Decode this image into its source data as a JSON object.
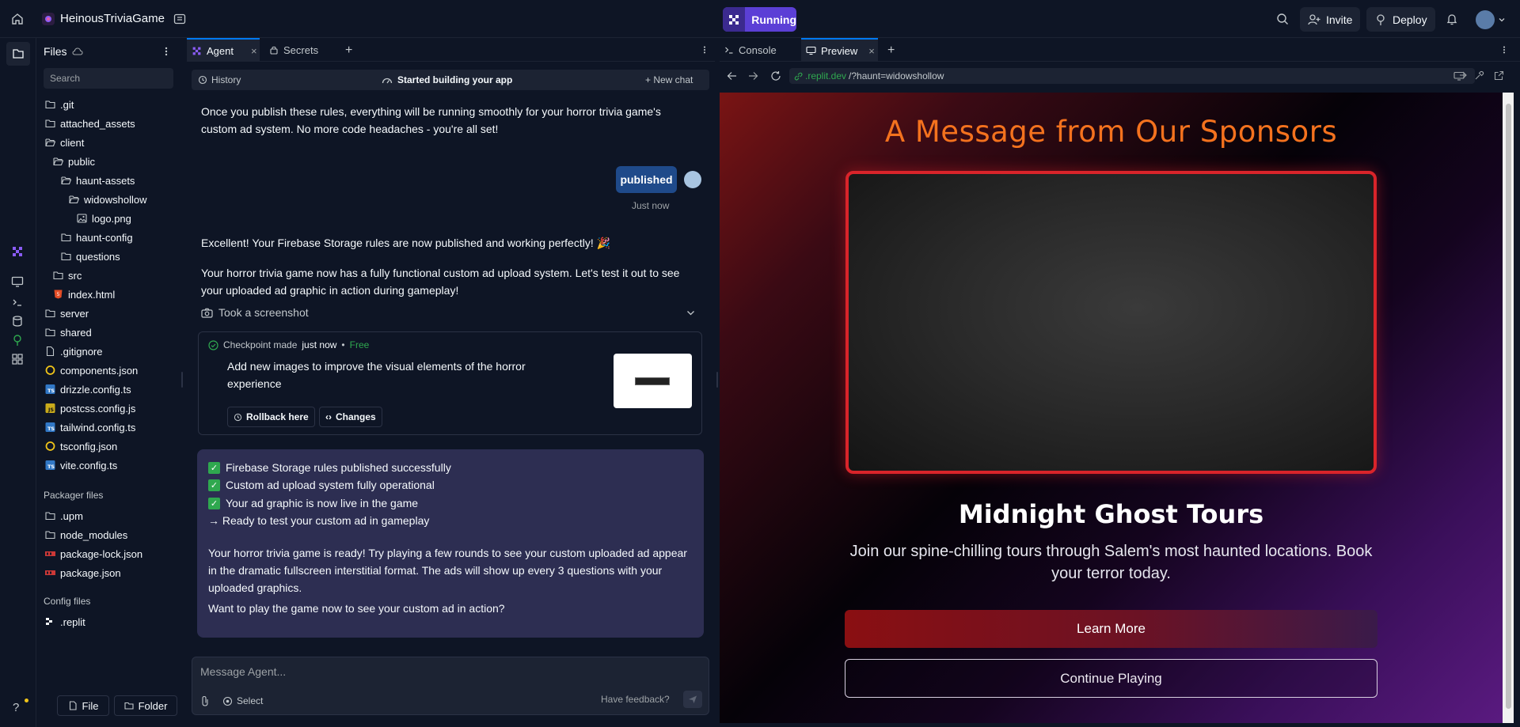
{
  "topbar": {
    "app_name": "HeinousTriviaGame",
    "run_label": "Running",
    "invite_label": "Invite",
    "deploy_label": "Deploy"
  },
  "files": {
    "title": "Files",
    "search_placeholder": "Search",
    "tree": [
      {
        "name": ".git",
        "type": "folder",
        "depth": 0
      },
      {
        "name": "attached_assets",
        "type": "folder",
        "depth": 0
      },
      {
        "name": "client",
        "type": "folder-open",
        "depth": 0
      },
      {
        "name": "public",
        "type": "folder-open",
        "depth": 1
      },
      {
        "name": "haunt-assets",
        "type": "folder-open",
        "depth": 2
      },
      {
        "name": "widowshollow",
        "type": "folder-open",
        "depth": 3
      },
      {
        "name": "logo.png",
        "type": "image",
        "depth": 4
      },
      {
        "name": "haunt-config",
        "type": "folder",
        "depth": 2
      },
      {
        "name": "questions",
        "type": "folder",
        "depth": 2
      },
      {
        "name": "src",
        "type": "folder",
        "depth": 1
      },
      {
        "name": "index.html",
        "type": "html",
        "depth": 1
      },
      {
        "name": "server",
        "type": "folder",
        "depth": 0
      },
      {
        "name": "shared",
        "type": "folder",
        "depth": 0
      },
      {
        "name": ".gitignore",
        "type": "file",
        "depth": 0
      },
      {
        "name": "components.json",
        "type": "json",
        "depth": 0
      },
      {
        "name": "drizzle.config.ts",
        "type": "ts",
        "depth": 0
      },
      {
        "name": "postcss.config.js",
        "type": "js",
        "depth": 0
      },
      {
        "name": "tailwind.config.ts",
        "type": "ts",
        "depth": 0
      },
      {
        "name": "tsconfig.json",
        "type": "json",
        "depth": 0
      },
      {
        "name": "vite.config.ts",
        "type": "ts",
        "depth": 0
      }
    ],
    "packager_label": "Packager files",
    "packager": [
      {
        "name": ".upm",
        "type": "folder"
      },
      {
        "name": "node_modules",
        "type": "folder"
      },
      {
        "name": "package-lock.json",
        "type": "npm"
      },
      {
        "name": "package.json",
        "type": "npm"
      }
    ],
    "config_label": "Config files",
    "config": [
      {
        "name": ".replit",
        "type": "replit"
      }
    ],
    "file_button": "File",
    "folder_button": "Folder"
  },
  "agent": {
    "tabs": [
      {
        "label": "Agent",
        "active": true
      },
      {
        "label": "Secrets",
        "active": false
      }
    ],
    "history_label": "History",
    "status_label": "Started building your app",
    "new_chat_label": "New chat",
    "msg1": "Once you publish these rules, everything will be running smoothly for your horror trivia game's custom ad system. No more code headaches - you're all set!",
    "user_msg": "published",
    "user_time": "Just now",
    "msg2": "Excellent! Your Firebase Storage rules are now published and working perfectly! 🎉",
    "msg3": "Your horror trivia game now has a fully functional custom ad upload system. Let's test it out to see your uploaded ad graphic in action during gameplay!",
    "screenshot_label": "Took a screenshot",
    "checkpoint": {
      "label": "Checkpoint made",
      "time": "just now",
      "price": "Free",
      "text": "Add new images to improve the visual elements of the horror experience",
      "rollback_label": "Rollback here",
      "changes_label": "Changes"
    },
    "summary": {
      "checks": [
        "Firebase Storage rules published successfully",
        "Custom ad upload system fully operational",
        "Your ad graphic is now live in the game"
      ],
      "arrow_line": "→ Ready to test your custom ad in gameplay",
      "para1": "Your horror trivia game is ready! Try playing a few rounds to see your custom uploaded ad appear in the dramatic fullscreen interstitial format. The ads will show up every 3 questions with your uploaded graphics.",
      "para2": "Want to play the game now to see your custom ad in action?"
    },
    "composer_placeholder": "Message Agent...",
    "select_label": "Select",
    "feedback_label": "Have feedback?"
  },
  "preview": {
    "tabs": [
      {
        "label": "Console",
        "active": false
      },
      {
        "label": "Preview",
        "active": true
      }
    ],
    "url_domain": ".replit.dev",
    "url_path": "/?haunt=widowshollow",
    "page": {
      "heading": "A Message from Our Sponsors",
      "ad_name": "Midnight Ghost Tours",
      "ad_desc": "Join our spine-chilling tours through Salem's most haunted locations. Book your terror today.",
      "learn_more": "Learn More",
      "continue": "Continue Playing"
    }
  },
  "colors": {
    "accent": "#0079f2",
    "run": "#5b3fd6",
    "sponsor_title": "#f4721e",
    "ad_border": "#d9242a",
    "summary_bg": "#2d2e52"
  }
}
